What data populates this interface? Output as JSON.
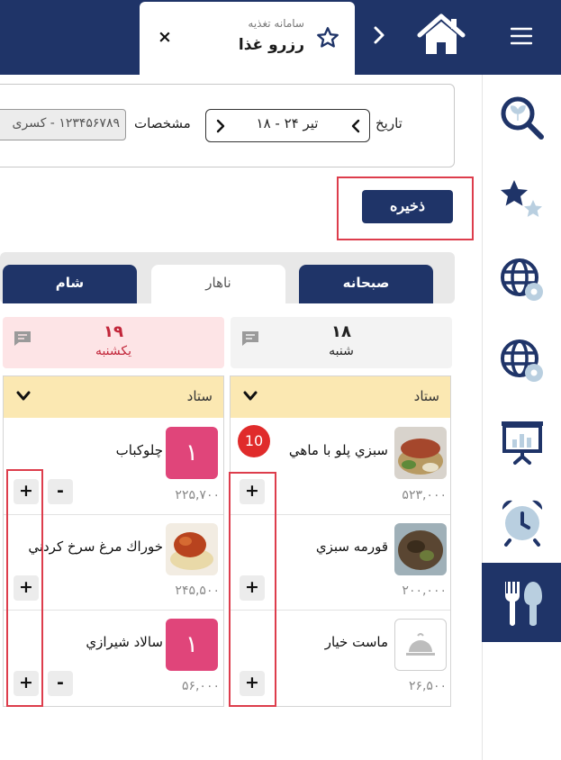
{
  "header": {
    "tab_subtitle": "سامانه تغذیه",
    "tab_title": "رزرو غذا",
    "close_label": "×"
  },
  "form": {
    "date_label": "تاریخ",
    "date_value": "تیر ۲۴ - ۱۸",
    "spec_label": "مشخصات",
    "spec_value": "۱۲۳۴۵۶۷۸۹ - کسری"
  },
  "actions": {
    "save_label": "ذخیره"
  },
  "meal_tabs": [
    {
      "label": "صبحانه",
      "active": false
    },
    {
      "label": "ناهار",
      "active": true
    },
    {
      "label": "شام",
      "active": false
    }
  ],
  "days": [
    {
      "num": "۱۸",
      "name": "شنبه",
      "highlight": false
    },
    {
      "num": "۱۹",
      "name": "یکشنبه",
      "highlight": true
    }
  ],
  "columns": [
    {
      "staff_label": "ستاد",
      "items": [
        {
          "name": "سبزي پلو با ماهي",
          "price": "۵۲۳,۰۰۰",
          "image": "fish-rice-photo",
          "qty": ""
        },
        {
          "name": "قورمه سبزي",
          "price": "۲۰۰,۰۰۰",
          "image": "stew-photo",
          "qty": ""
        },
        {
          "name": "ماست خيار",
          "price": "۲۶,۵۰۰",
          "image": "cloche-placeholder",
          "qty": ""
        }
      ]
    },
    {
      "staff_label": "ستاد",
      "items": [
        {
          "name": "چلوكباب",
          "price": "۲۲۵,۷۰۰",
          "image": "qty-tile",
          "qty": "۱"
        },
        {
          "name": "خوراك مرغ سرخ كردني",
          "price": "۲۴۵,۵۰۰",
          "image": "fried-chicken-photo",
          "qty": ""
        },
        {
          "name": "سالاد شيرازي",
          "price": "۵۶,۰۰۰",
          "image": "qty-tile",
          "qty": "۱"
        }
      ]
    }
  ],
  "badge_count": "10",
  "controls": {
    "plus": "+",
    "minus": "-"
  },
  "sidebar": [
    "menu-icon",
    "search-plant-icon",
    "stars-icon",
    "globe-gear-icon",
    "globe-gear-icon",
    "presentation-icon",
    "alarm-clock-icon",
    "food-utensils-icon"
  ],
  "colors": {
    "navy": "#1f3468",
    "staff_bar": "#fbe8b2",
    "sunday_bg": "#fde4e6",
    "sunday_text": "#c2263a",
    "qty_tile": "#e0457a",
    "annotation": "#dd3d4c",
    "badge": "#e02b2b"
  }
}
